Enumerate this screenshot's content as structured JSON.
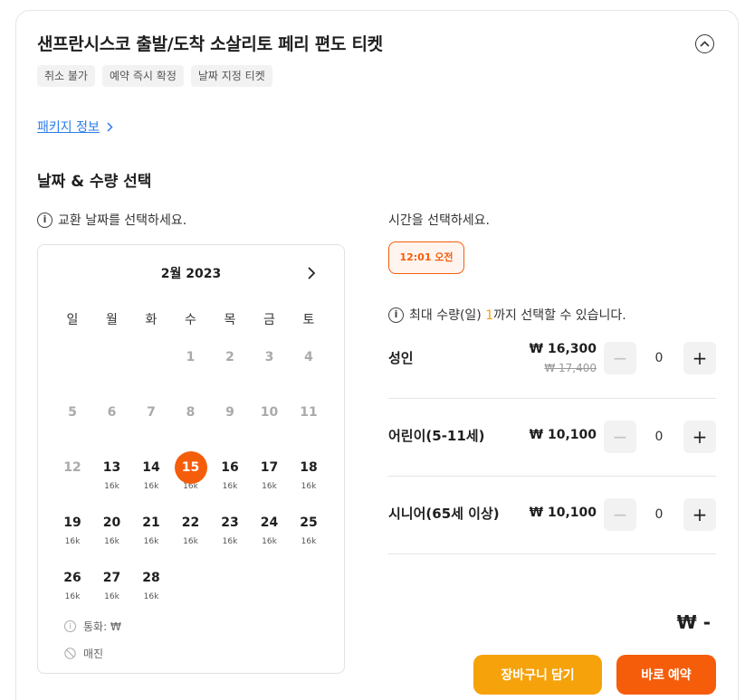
{
  "header": {
    "title": "샌프란시스코 출발/도착 소살리토 페리 편도 티켓",
    "tags": [
      "취소 불가",
      "예약 즉시 확정",
      "날짜 지정 티켓"
    ]
  },
  "package_link": {
    "label": "패키지 정보",
    "icon": "chevron-right-icon"
  },
  "section": {
    "title": "날짜 & 수량 선택"
  },
  "date_hint": "교환 날짜를 선택하세요.",
  "time_hint": "시간을 선택하세요.",
  "calendar": {
    "month": "2월 2023",
    "weekdays": [
      "일",
      "월",
      "화",
      "수",
      "목",
      "금",
      "토"
    ],
    "first_weekday_index": 3,
    "selected_day": 15,
    "days": [
      {
        "d": "1",
        "p": ""
      },
      {
        "d": "2",
        "p": ""
      },
      {
        "d": "3",
        "p": ""
      },
      {
        "d": "4",
        "p": ""
      },
      {
        "d": "5",
        "p": ""
      },
      {
        "d": "6",
        "p": ""
      },
      {
        "d": "7",
        "p": ""
      },
      {
        "d": "8",
        "p": ""
      },
      {
        "d": "9",
        "p": ""
      },
      {
        "d": "10",
        "p": ""
      },
      {
        "d": "11",
        "p": ""
      },
      {
        "d": "12",
        "p": ""
      },
      {
        "d": "13",
        "p": "16k"
      },
      {
        "d": "14",
        "p": "16k"
      },
      {
        "d": "15",
        "p": "16k"
      },
      {
        "d": "16",
        "p": "16k"
      },
      {
        "d": "17",
        "p": "16k"
      },
      {
        "d": "18",
        "p": "16k"
      },
      {
        "d": "19",
        "p": "16k"
      },
      {
        "d": "20",
        "p": "16k"
      },
      {
        "d": "21",
        "p": "16k"
      },
      {
        "d": "22",
        "p": "16k"
      },
      {
        "d": "23",
        "p": "16k"
      },
      {
        "d": "24",
        "p": "16k"
      },
      {
        "d": "25",
        "p": "16k"
      },
      {
        "d": "26",
        "p": "16k"
      },
      {
        "d": "27",
        "p": "16k"
      },
      {
        "d": "28",
        "p": "16k"
      }
    ],
    "legend_currency": "통화: ₩",
    "legend_soldout": "매진"
  },
  "time_slot": {
    "label": "12:01 오전",
    "selected": true
  },
  "qty_hint": {
    "prefix": "최대 수량(일) ",
    "max": "1",
    "suffix": "까지 선택할 수 있습니다."
  },
  "rows": [
    {
      "label": "성인",
      "price": "₩ 16,300",
      "original_price": "₩ 17,400",
      "quantity": "0"
    },
    {
      "label": "어린이(5-11세)",
      "price": "₩ 10,100",
      "original_price": "",
      "quantity": "0"
    },
    {
      "label": "시니어(65세 이상)",
      "price": "₩ 10,100",
      "original_price": "",
      "quantity": "0"
    }
  ],
  "total": "₩ -",
  "buttons": {
    "cart": "장바구니 담기",
    "buy": "바로 예약"
  },
  "colors": {
    "accent": "#f55d0b",
    "secondary": "#f5a20b",
    "link": "#2b7de9"
  }
}
